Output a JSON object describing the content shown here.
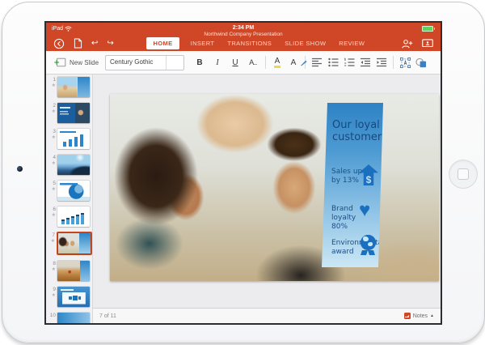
{
  "status": {
    "carrier": "iPad",
    "time": "2:34 PM"
  },
  "header": {
    "document_title": "Northwind Company Presentation",
    "tabs": [
      {
        "label": "HOME",
        "active": true
      },
      {
        "label": "INSERT",
        "active": false
      },
      {
        "label": "TRANSITIONS",
        "active": false
      },
      {
        "label": "SLIDE SHOW",
        "active": false
      },
      {
        "label": "REVIEW",
        "active": false
      }
    ]
  },
  "toolbar": {
    "new_slide_label": "New Slide",
    "font_name": "Century Gothic",
    "font_size": "",
    "bold": "B",
    "italic": "I",
    "underline": "U",
    "more_formatting": "A..",
    "highlight": "A",
    "font_color": "A"
  },
  "sidebar": {
    "slides": [
      {
        "num": "1"
      },
      {
        "num": "2"
      },
      {
        "num": "3"
      },
      {
        "num": "4"
      },
      {
        "num": "5"
      },
      {
        "num": "6"
      },
      {
        "num": "7",
        "selected": true
      },
      {
        "num": "8"
      },
      {
        "num": "9"
      },
      {
        "num": "10"
      }
    ]
  },
  "slide": {
    "title": "Our loyal customers",
    "items": [
      {
        "text": "Sales up by 13%",
        "icon": "dollar-arrow-icon",
        "symbol": "$"
      },
      {
        "text": "Brand loyalty 80%",
        "icon": "heart-icon",
        "symbol": "♥"
      },
      {
        "text": "Environmental award",
        "icon": "globe-award-icon"
      }
    ]
  },
  "footer": {
    "page_indicator": "7 of 11",
    "notes_label": "Notes"
  },
  "icons": {
    "star": "★",
    "undo": "↩",
    "redo": "↪",
    "collapse": "▲"
  },
  "colors": {
    "accent": "#D04727",
    "panel_top": "#2E82C4",
    "panel_bottom": "#CBE7F5",
    "panel_text": "#17487D",
    "icon_blue": "#1B6FBF"
  }
}
